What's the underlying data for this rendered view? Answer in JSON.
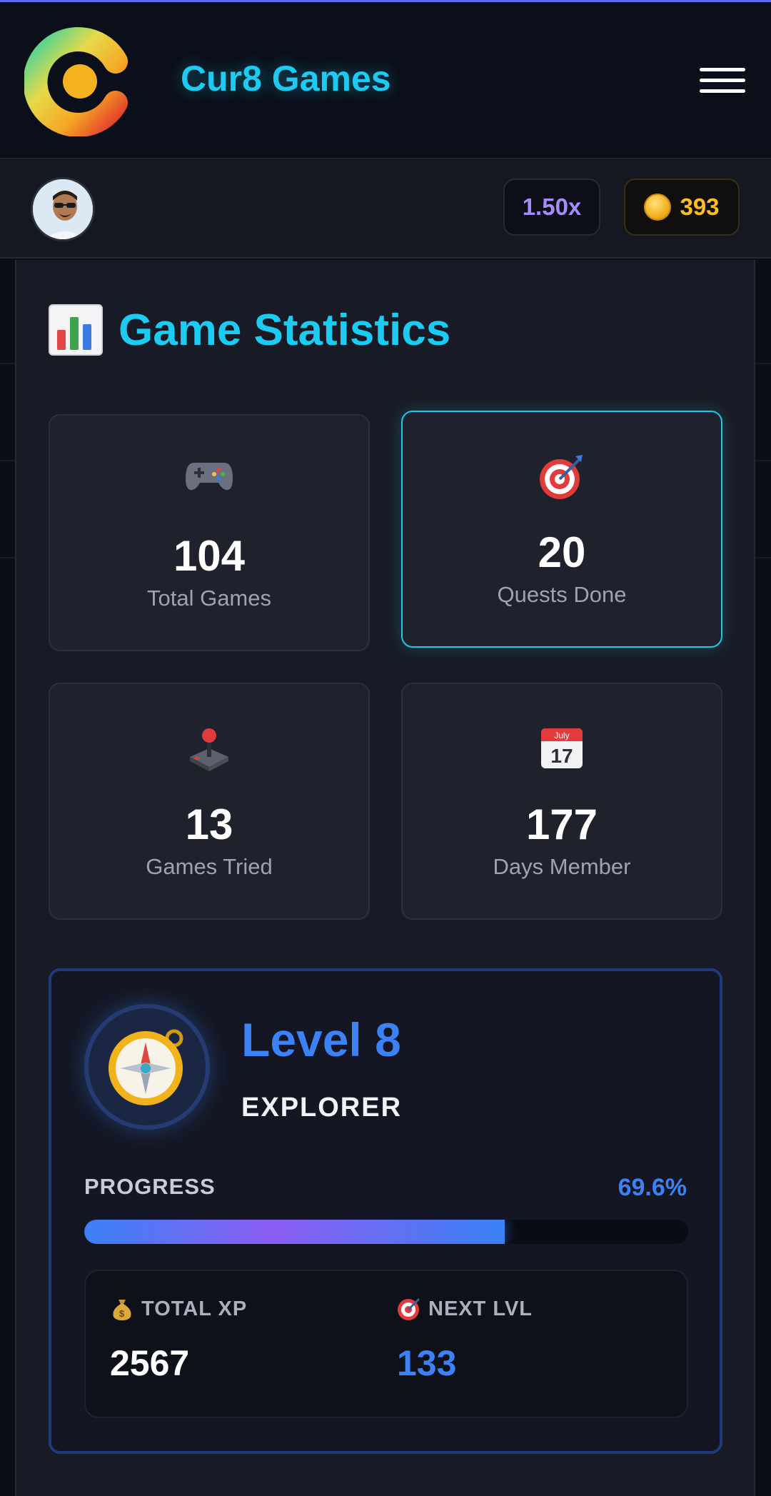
{
  "header": {
    "brand": "Cur8 Games",
    "logo_icon": "cur8-logo-icon",
    "menu_icon": "hamburger-menu-icon"
  },
  "userbar": {
    "avatar_icon": "user-avatar",
    "multiplier": "1.50x",
    "coins": "393",
    "coin_icon": "coin-icon"
  },
  "stats": {
    "title": "Game Statistics",
    "title_icon": "bar-chart-icon",
    "cards": [
      {
        "icon": "gamepad-icon",
        "value": "104",
        "label": "Total Games"
      },
      {
        "icon": "target-icon",
        "value": "20",
        "label": "Quests Done"
      },
      {
        "icon": "joystick-icon",
        "value": "13",
        "label": "Games Tried"
      },
      {
        "icon": "calendar-icon",
        "value": "177",
        "label": "Days Member",
        "calendar_month": "July",
        "calendar_day": "17"
      }
    ]
  },
  "level": {
    "badge_icon": "compass-icon",
    "title": "Level 8",
    "rank": "EXPLORER",
    "progress_label": "PROGRESS",
    "progress_text": "69.6%",
    "progress_fraction": 0.696,
    "total_xp_label": "TOTAL XP",
    "total_xp_icon": "money-bag-icon",
    "total_xp": "2567",
    "next_lvl_label": "NEXT LVL",
    "next_lvl_icon": "target-icon",
    "next_lvl": "133"
  },
  "colors": {
    "accent_cyan": "#1ccbf2",
    "accent_blue": "#3b82f6",
    "multiplier_purple": "#a78bfa",
    "coin_gold": "#fbbf24"
  }
}
